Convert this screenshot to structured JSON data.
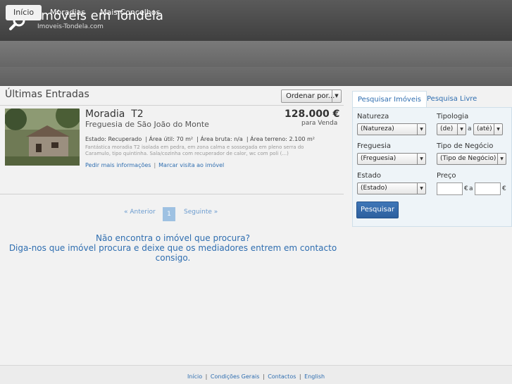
{
  "site": {
    "title": "Imóveis em Tondela",
    "subtitle": "Imoveis-Tondela.com"
  },
  "nav": {
    "items": [
      {
        "label": "Início"
      },
      {
        "label": "Moradias"
      },
      {
        "label": "Mais Concelhos"
      }
    ],
    "active_index": 0
  },
  "listing_section": {
    "title": "Últimas Entradas",
    "order_select": {
      "selected": "Ordenar por..."
    }
  },
  "listing": {
    "title": "Moradia  T2",
    "parish": "Freguesia de São João do Monte",
    "price": "128.000 €",
    "mode": "para Venda",
    "details": "Estado: Recuperado  | Área útil: 70 m²  | Área bruta: n/a  | Área terreno: 2.100 m²",
    "description": "Fantástica moradia T2 isolada em pedra, em zona calma e sossegada em pleno serra do Caramulo, tipo quintinha. Sala/cozinha com recuperador de calor, wc com poli (...)",
    "links": {
      "info": "Pedir mais informações",
      "separator": "|",
      "visit": "Marcar visita ao imóvel"
    }
  },
  "pager": {
    "prev": "« Anterior",
    "current": "1",
    "next": "Seguinte »"
  },
  "prompt": {
    "line1": "Não encontra o imóvel que procura?",
    "line2": "Diga-nos que imóvel procura e deixe que os mediadores entrem em contacto consigo."
  },
  "search": {
    "tabs": [
      {
        "label": "Pesquisar Imóveis"
      },
      {
        "label": "Pesquisa Livre"
      }
    ],
    "natureza": {
      "label": "Natureza",
      "selected": "(Natureza)"
    },
    "tipologia": {
      "label": "Tipologia",
      "from": "(de)",
      "connector": "a",
      "to": "(até)"
    },
    "freguesia": {
      "label": "Freguesia",
      "selected": "(Freguesia)"
    },
    "tipo_negocio": {
      "label": "Tipo de Negócio",
      "selected": "(Tipo de Negócio)"
    },
    "estado": {
      "label": "Estado",
      "selected": "(Estado)"
    },
    "preco": {
      "label": "Preço",
      "from_value": "",
      "currency1": "€",
      "connector": "a",
      "to_value": "",
      "currency2": "€"
    },
    "submit": "Pesquisar"
  },
  "footer": {
    "links": [
      "Início",
      "Condições Gerais",
      "Contactos",
      "English"
    ],
    "separator": "|"
  },
  "colors": {
    "header": "#4a4a4a",
    "nav": "#6f6f6f",
    "link": "#2f6eb0",
    "button": "#2c5f9e",
    "panel": "#eef4f8"
  }
}
